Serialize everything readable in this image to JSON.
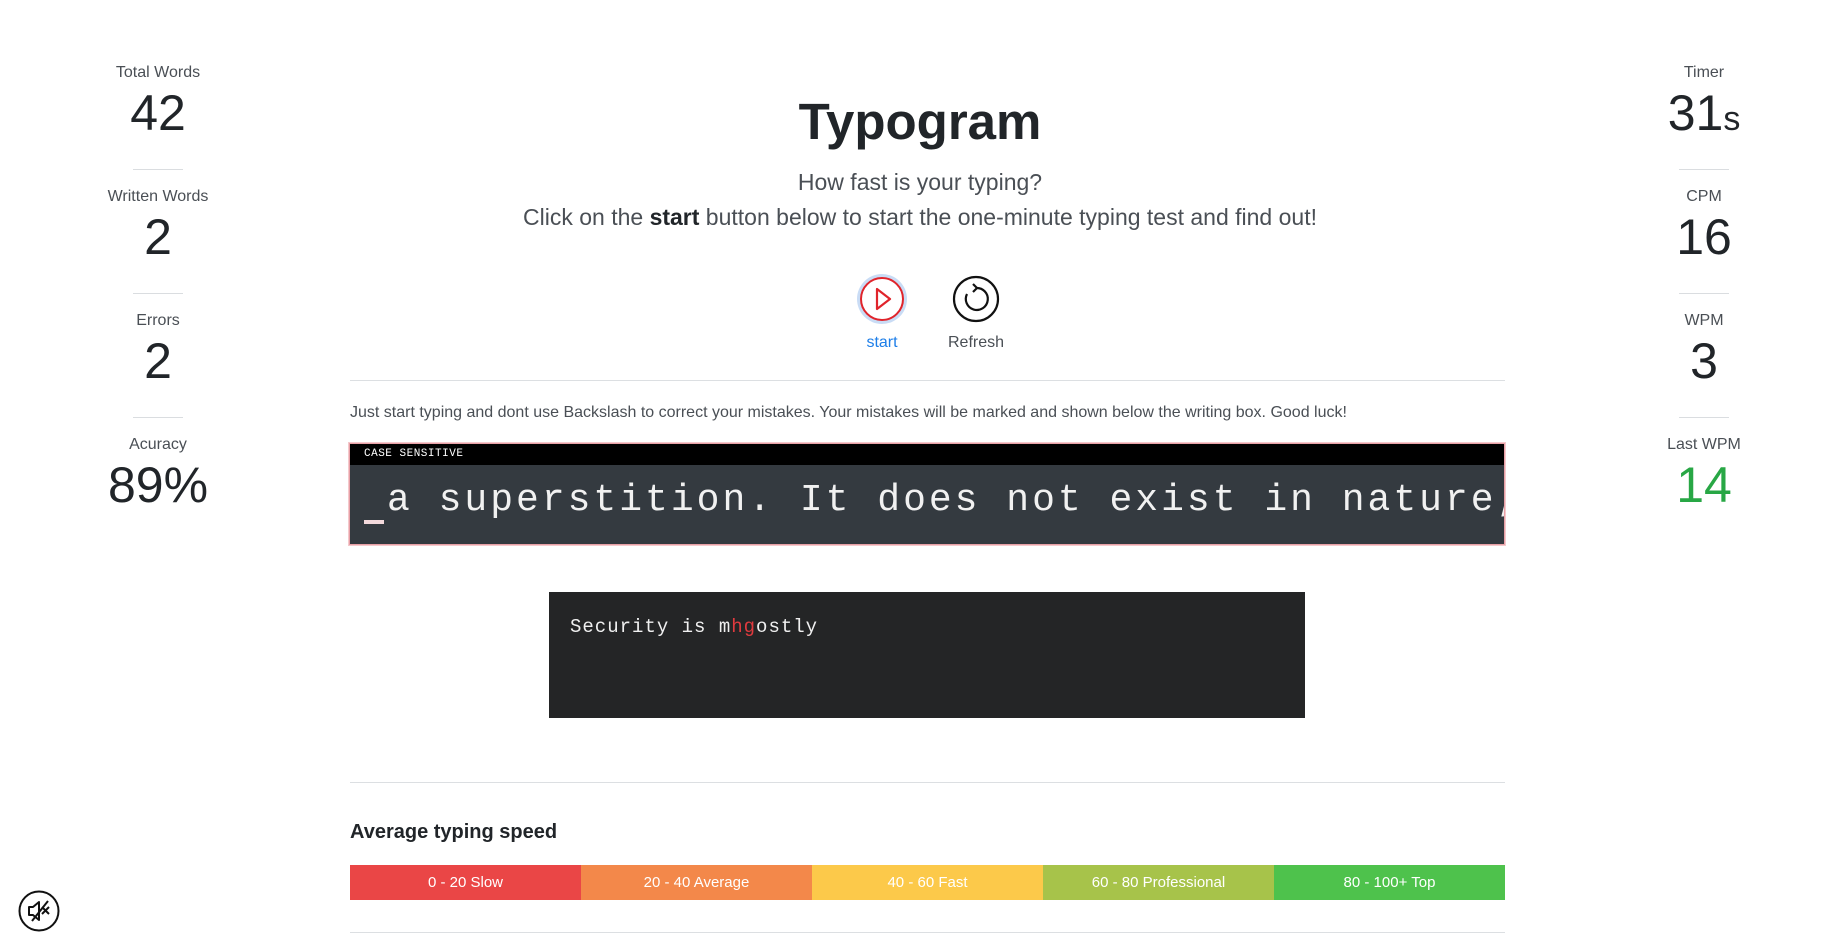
{
  "stats_left": [
    {
      "label": "Total Words",
      "value": "42"
    },
    {
      "label": "Written Words",
      "value": "2"
    },
    {
      "label": "Errors",
      "value": "2"
    },
    {
      "label": "Acuracy",
      "value": "89%"
    }
  ],
  "stats_right": {
    "timer": {
      "label": "Timer",
      "value": "31",
      "unit": "s"
    },
    "cpm": {
      "label": "CPM",
      "value": "16"
    },
    "wpm": {
      "label": "WPM",
      "value": "3"
    },
    "last_wpm": {
      "label": "Last WPM",
      "value": "14"
    }
  },
  "header": {
    "title": "Typogram",
    "subtitle": "How fast is your typing?",
    "instruction_pre": "Click on the ",
    "instruction_bold": "start",
    "instruction_post": " button below to start the one-minute typing test and find out!"
  },
  "controls": {
    "start_label": "start",
    "refresh_label": "Refresh",
    "start_icon": "play-circle-icon",
    "refresh_icon": "refresh-icon"
  },
  "hint": "Just start typing and dont use Backslash to correct your mistakes. Your mistakes will be marked and shown below the writing box. Good luck!",
  "typing_box": {
    "header": "CASE SENSITIVE",
    "text": "a superstition. It does not exist in nature, n"
  },
  "result": {
    "part1": "Security is m",
    "error": "hg",
    "part2": "ostly"
  },
  "average": {
    "title": "Average typing speed",
    "segments": [
      {
        "label": "0 - 20 Slow",
        "color": "#ea4646"
      },
      {
        "label": "20 - 40 Average",
        "color": "#f3884a"
      },
      {
        "label": "40 - 60 Fast",
        "color": "#fcc94a"
      },
      {
        "label": "60 - 80 Professional",
        "color": "#a7c34a"
      },
      {
        "label": "80 - 100+ Top",
        "color": "#4ec24c"
      }
    ]
  },
  "sound": {
    "icon": "mute-speaker-icon"
  },
  "colors": {
    "accent_blue": "#1d7ee8",
    "error_red": "#e03a3e",
    "green": "#28a745"
  }
}
